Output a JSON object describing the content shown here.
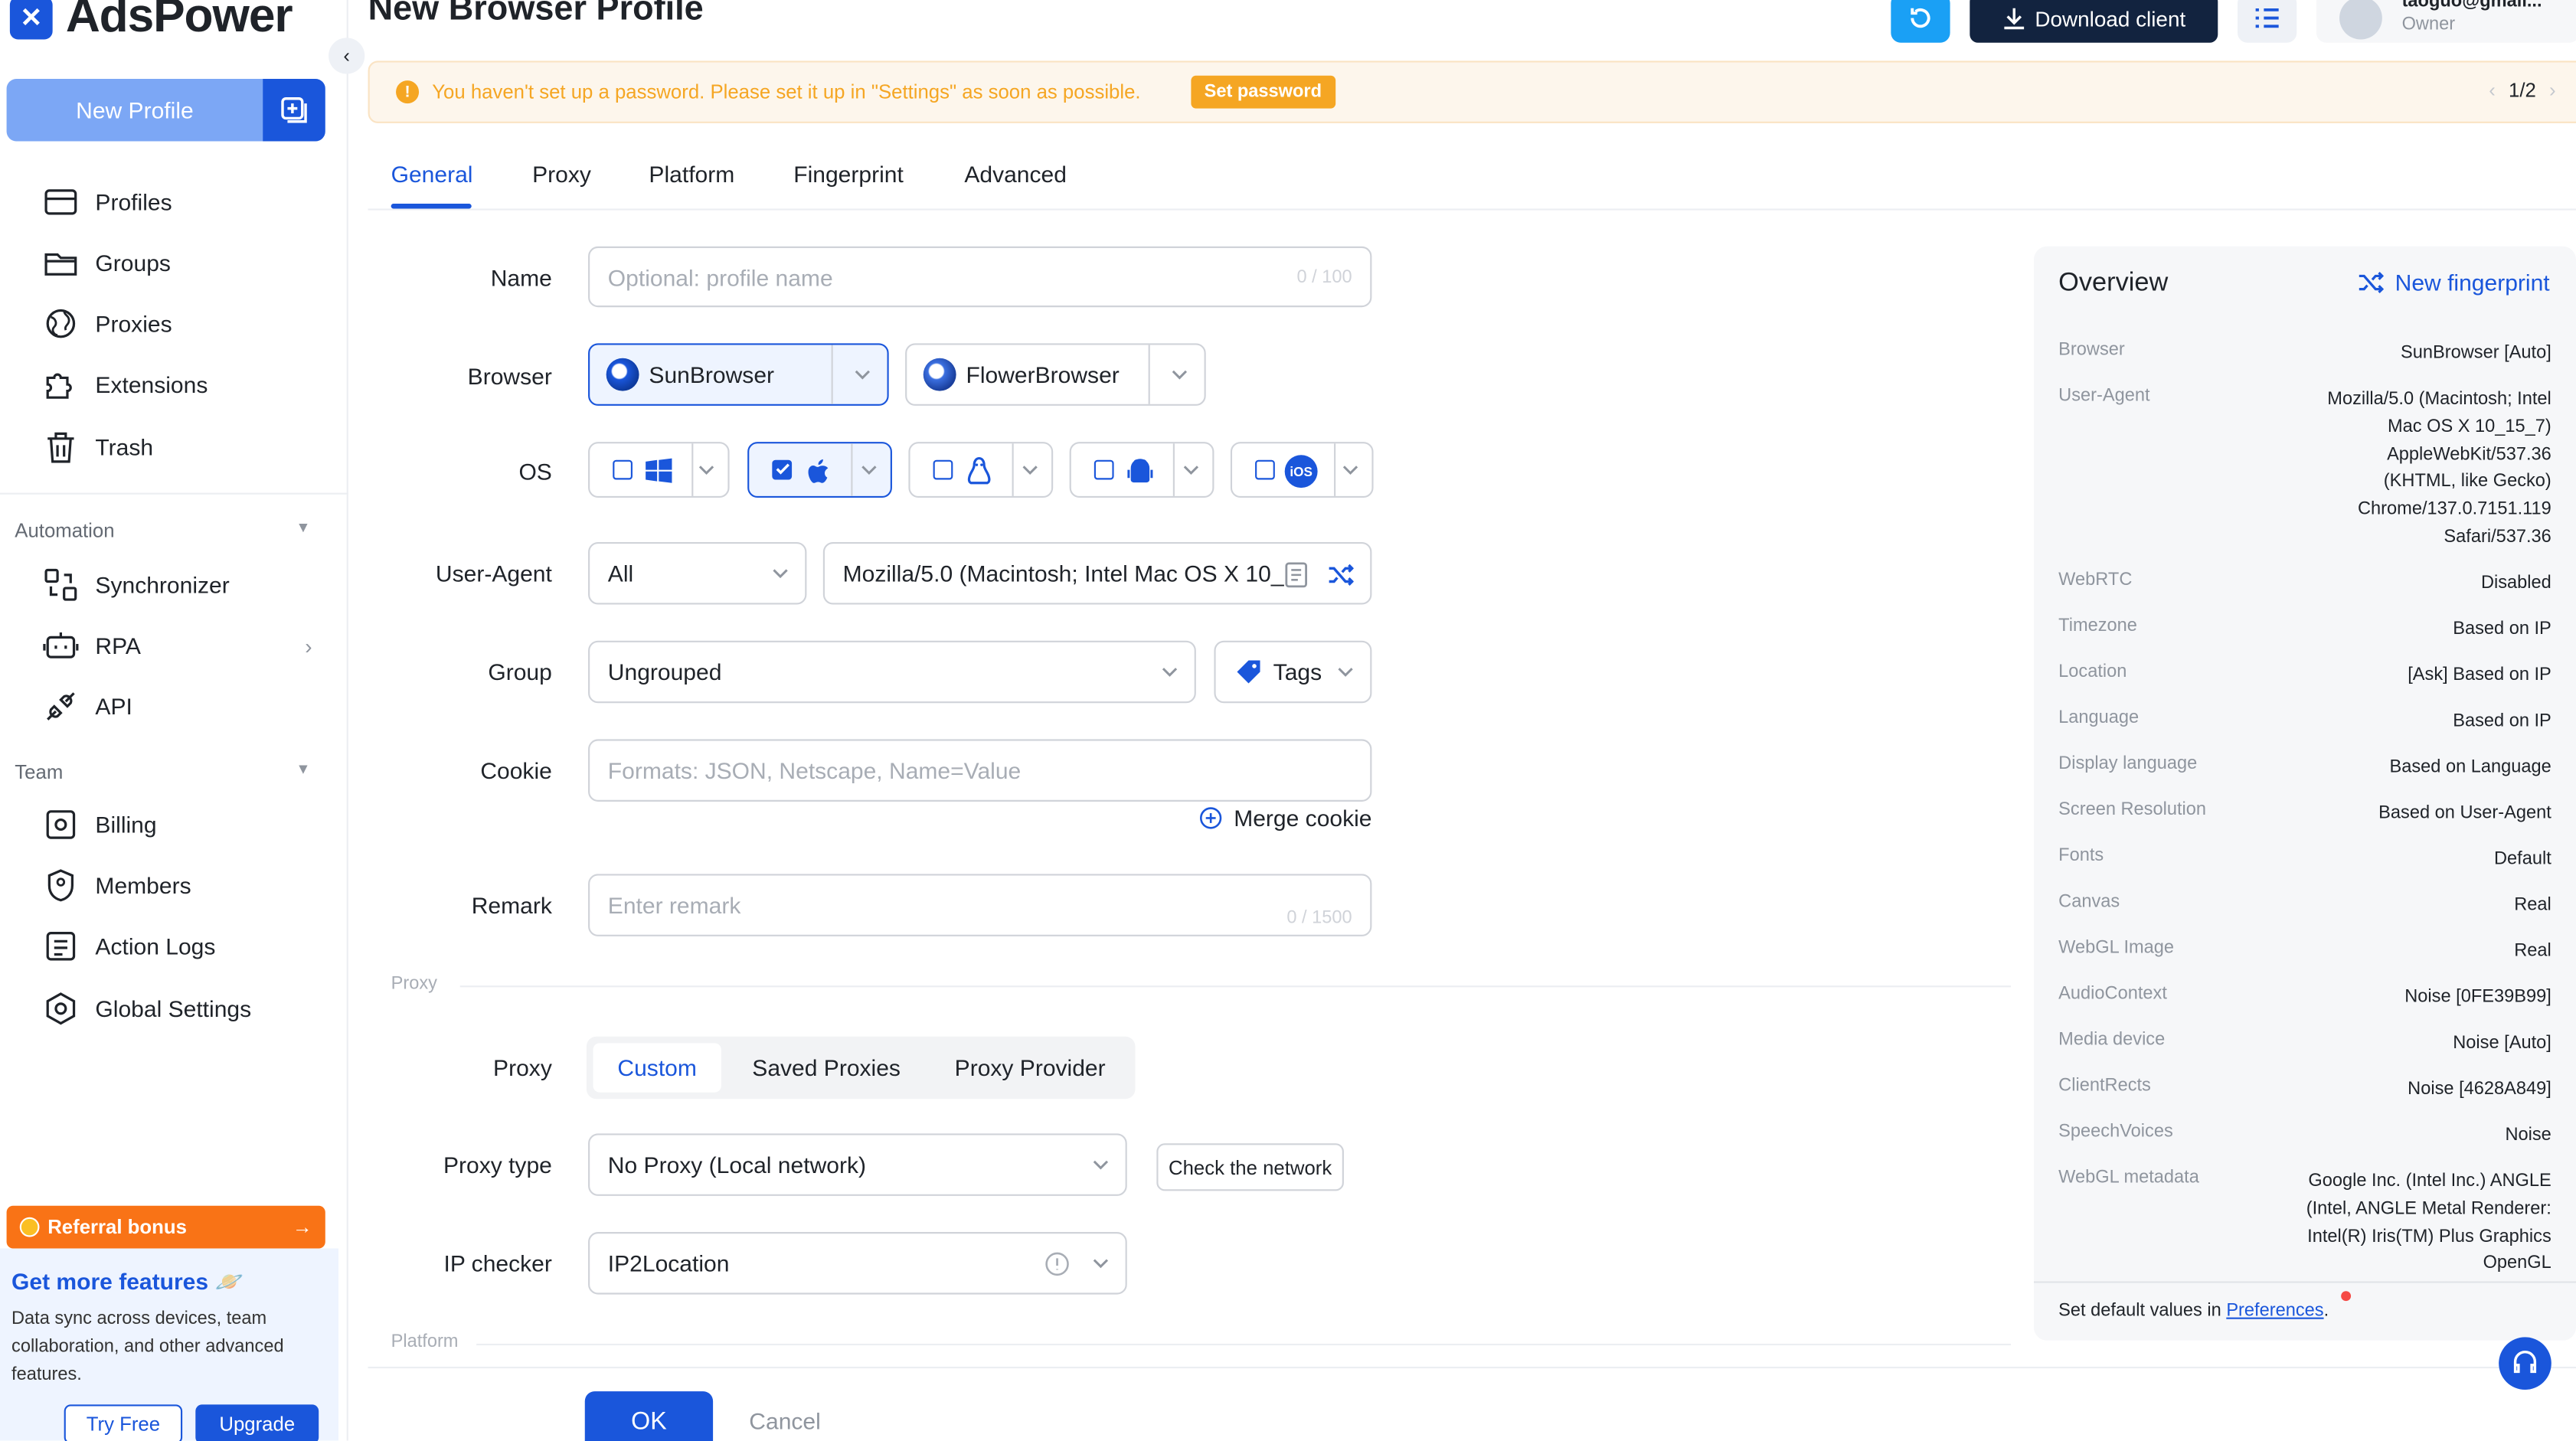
{
  "app": {
    "name": "AdsPower",
    "page_title": "New Browser Profile"
  },
  "sidebar": {
    "new_profile_label": "New Profile",
    "main_items": [
      {
        "label": "Profiles",
        "icon": "profiles-icon"
      },
      {
        "label": "Groups",
        "icon": "folder-icon"
      },
      {
        "label": "Proxies",
        "icon": "globe-icon"
      },
      {
        "label": "Extensions",
        "icon": "puzzle-icon"
      },
      {
        "label": "Trash",
        "icon": "trash-icon"
      }
    ],
    "automation_label": "Automation",
    "automation_items": [
      {
        "label": "Synchronizer",
        "icon": "sync-icon"
      },
      {
        "label": "RPA",
        "icon": "robot-icon"
      },
      {
        "label": "API",
        "icon": "api-icon"
      }
    ],
    "team_label": "Team",
    "team_items": [
      {
        "label": "Billing",
        "icon": "billing-icon"
      },
      {
        "label": "Members",
        "icon": "shield-icon"
      },
      {
        "label": "Action Logs",
        "icon": "log-icon"
      },
      {
        "label": "Global Settings",
        "icon": "settings-icon"
      }
    ],
    "referral_label": "Referral bonus",
    "promo_title": "Get more features",
    "promo_text": "Data sync across devices, team collaboration, and other advanced features.",
    "try_free": "Try Free",
    "upgrade": "Upgrade"
  },
  "header": {
    "download_label": "Download client",
    "user_email": "taoguo@gmail...",
    "user_role": "Owner"
  },
  "banner": {
    "text": "You haven't set up a password. Please set it up in \"Settings\" as soon as possible.",
    "button": "Set password",
    "pager": "1/2"
  },
  "tabs": [
    "General",
    "Proxy",
    "Platform",
    "Fingerprint",
    "Advanced"
  ],
  "form": {
    "name_label": "Name",
    "name_placeholder": "Optional: profile name",
    "name_counter": "0 / 100",
    "browser_label": "Browser",
    "browser_options": [
      "SunBrowser",
      "FlowerBrowser"
    ],
    "os_label": "OS",
    "os_selected": "macOS",
    "ua_label": "User-Agent",
    "ua_select": "All",
    "ua_value": "Mozilla/5.0 (Macintosh; Intel Mac OS X 10_...",
    "group_label": "Group",
    "group_value": "Ungrouped",
    "tags_label": "Tags",
    "cookie_label": "Cookie",
    "cookie_placeholder": "Formats: JSON, Netscape, Name=Value",
    "merge_cookie": "Merge cookie",
    "remark_label": "Remark",
    "remark_placeholder": "Enter remark",
    "remark_counter": "0 / 1500",
    "proxy_section": "Proxy",
    "proxy_label": "Proxy",
    "proxy_modes": [
      "Custom",
      "Saved Proxies",
      "Proxy Provider"
    ],
    "proxy_type_label": "Proxy type",
    "proxy_type_value": "No Proxy (Local network)",
    "check_network": "Check the network",
    "ip_checker_label": "IP checker",
    "ip_checker_value": "IP2Location",
    "platform_section": "Platform"
  },
  "footer": {
    "ok": "OK",
    "cancel": "Cancel"
  },
  "overview": {
    "title": "Overview",
    "new_fingerprint": "New fingerprint",
    "rows": [
      {
        "key": "Browser",
        "value": "SunBrowser [Auto]"
      },
      {
        "key": "User-Agent",
        "value": "Mozilla/5.0 (Macintosh; Intel Mac OS X 10_15_7) AppleWebKit/537.36 (KHTML, like Gecko) Chrome/137.0.7151.119 Safari/537.36"
      },
      {
        "key": "WebRTC",
        "value": "Disabled"
      },
      {
        "key": "Timezone",
        "value": "Based on IP"
      },
      {
        "key": "Location",
        "value": "[Ask] Based on IP"
      },
      {
        "key": "Language",
        "value": "Based on IP"
      },
      {
        "key": "Display language",
        "value": "Based on Language"
      },
      {
        "key": "Screen Resolution",
        "value": "Based on User-Agent"
      },
      {
        "key": "Fonts",
        "value": "Default"
      },
      {
        "key": "Canvas",
        "value": "Real"
      },
      {
        "key": "WebGL Image",
        "value": "Real"
      },
      {
        "key": "AudioContext",
        "value": "Noise [0FE39B99]"
      },
      {
        "key": "Media device",
        "value": "Noise [Auto]"
      },
      {
        "key": "ClientRects",
        "value": "Noise [4628A849]"
      },
      {
        "key": "SpeechVoices",
        "value": "Noise"
      },
      {
        "key": "WebGL metadata",
        "value": "Google Inc. (Intel Inc.) ANGLE (Intel, ANGLE Metal Renderer: Intel(R) Iris(TM) Plus Graphics OpenGL"
      }
    ],
    "footer_text": "Set default values in",
    "footer_link": "Preferences",
    "footer_end": "."
  },
  "colors": {
    "primary": "#1a56db",
    "warning": "#f5a623",
    "referral": "#f97316"
  }
}
